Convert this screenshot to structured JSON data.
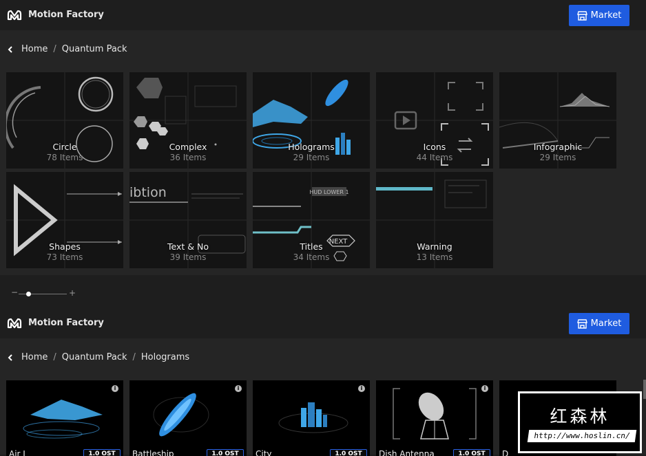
{
  "app": {
    "name": "Motion Factory",
    "market_label": "Market"
  },
  "breadcrumb1": {
    "items": [
      "Home",
      "Quantum Pack"
    ]
  },
  "categories": [
    {
      "name": "Circle",
      "count": "78 Items"
    },
    {
      "name": "Complex",
      "count": "36 Items"
    },
    {
      "name": "Holograms",
      "count": "29 Items"
    },
    {
      "name": "Icons",
      "count": "44 Items"
    },
    {
      "name": "Infographic",
      "count": "29 Items"
    },
    {
      "name": "Shapes",
      "count": "73 Items"
    },
    {
      "name": "Text & No",
      "count": "39 Items"
    },
    {
      "name": "Titles",
      "count": "34 Items"
    },
    {
      "name": "Warning",
      "count": "13 Items"
    }
  ],
  "zoom_slider": {
    "minus": "−",
    "plus": "+",
    "level": 0.2
  },
  "breadcrumb2": {
    "items": [
      "Home",
      "Quantum Pack",
      "Holograms"
    ]
  },
  "products": [
    {
      "name": "Air I",
      "price": "1.0 OST"
    },
    {
      "name": "Battleship",
      "price": "1.0 OST"
    },
    {
      "name": "City",
      "price": "1.0 OST"
    },
    {
      "name": "Dish Antenna",
      "price": "1.0 OST"
    },
    {
      "name": "D",
      "price": ""
    }
  ],
  "tile_text": {
    "titles_next": "NEXT",
    "titles_hud": "HUD LOWER 1",
    "text_ibition": "ibtion",
    "info": "i"
  },
  "watermark": {
    "chinese": "红森林",
    "url": "http://www.hoslin.cn/"
  },
  "colors": {
    "accent": "#1f5ce0",
    "holo": "#3fa7e8",
    "header_bg": "#1e1e1e",
    "panel_bg": "#252525"
  }
}
